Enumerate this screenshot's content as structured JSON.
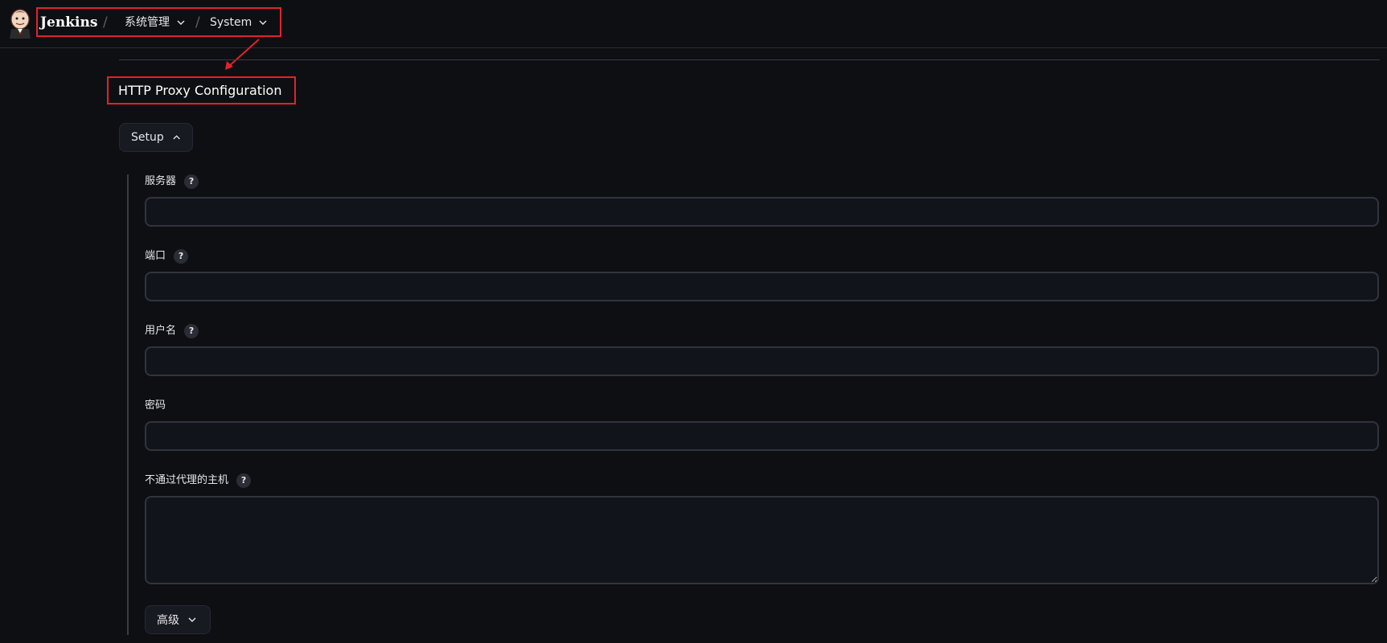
{
  "header": {
    "brand": "Jenkins",
    "breadcrumb": [
      {
        "label": "系统管理"
      },
      {
        "label": "System"
      }
    ],
    "separator": "/"
  },
  "section": {
    "title": "HTTP Proxy Configuration"
  },
  "setup": {
    "label": "Setup"
  },
  "fields": {
    "server": {
      "label": "服务器",
      "help": "?",
      "value": ""
    },
    "port": {
      "label": "端口",
      "help": "?",
      "value": ""
    },
    "username": {
      "label": "用户名",
      "help": "?",
      "value": ""
    },
    "password": {
      "label": "密码",
      "value": ""
    },
    "no_proxy_hosts": {
      "label": "不通过代理的主机",
      "help": "?",
      "value": ""
    }
  },
  "advanced": {
    "label": "高级"
  },
  "colors": {
    "background": "#0e0f13",
    "annotation_red": "#e0232a",
    "input_bg": "#11141b",
    "input_border": "#30343d"
  },
  "icons": {
    "logo": "jenkins-butler-logo",
    "chevron_down": "chevron-down-icon",
    "chevron_up": "chevron-up-icon",
    "help": "help-icon"
  }
}
